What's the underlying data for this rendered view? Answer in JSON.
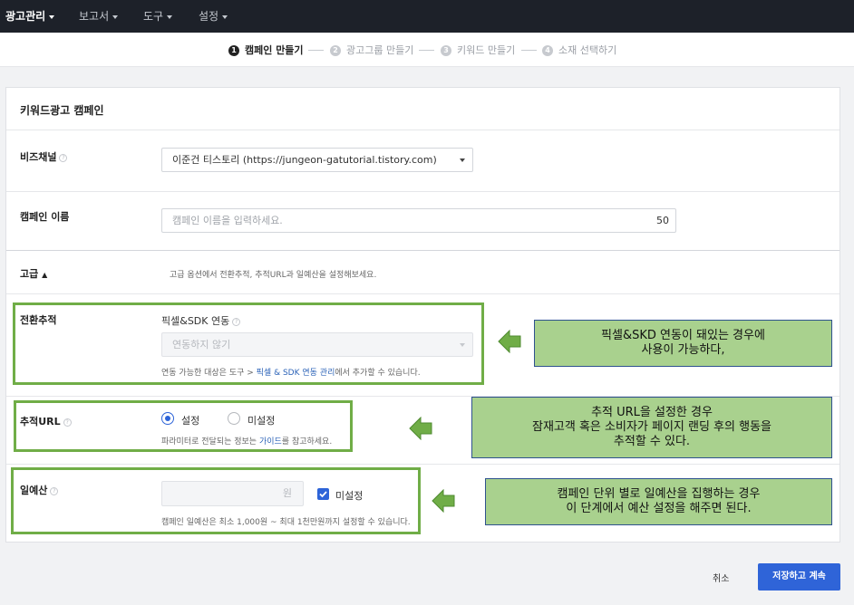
{
  "nav": {
    "items": [
      {
        "label": "광고관리"
      },
      {
        "label": "보고서"
      },
      {
        "label": "도구"
      },
      {
        "label": "설정"
      }
    ]
  },
  "steps": [
    {
      "num": "1",
      "label": "캠페인 만들기"
    },
    {
      "num": "2",
      "label": "광고그룹 만들기"
    },
    {
      "num": "3",
      "label": "키워드 만들기"
    },
    {
      "num": "4",
      "label": "소재 선택하기"
    }
  ],
  "card": {
    "title": "키워드광고 캠페인",
    "biz_channel": {
      "label": "비즈채널",
      "value": "이준건 티스토리 (https://jungeon-gatutorial.tistory.com)"
    },
    "campaign_name": {
      "label": "캠페인 이름",
      "placeholder": "캠페인 이름을 입력하세요.",
      "counter": "50"
    },
    "advanced": {
      "label": "고급",
      "description": "고급 옵션에서 전환추적, 추적URL과 일예산을 설정해보세요."
    },
    "conversion": {
      "label": "전환추적",
      "sub_label": "픽셀&SDK 연동",
      "select_value": "연동하지 않기",
      "hint_prefix": "연동 가능한 대상은 도구 > ",
      "hint_link": "픽셀 & SDK 연동 관리",
      "hint_suffix": "에서 추가할 수 있습니다."
    },
    "tracking_url": {
      "label": "추적URL",
      "option_on": "설정",
      "option_off": "미설정",
      "selected": "설정",
      "hint_prefix": "파라미터로 전달되는 정보는 ",
      "hint_link": "가이드",
      "hint_suffix": "를 참고하세요."
    },
    "daily_budget": {
      "label": "일예산",
      "unit": "원",
      "unset_label": "미설정",
      "unset_checked": true,
      "hint": "캠페인 일예산은 최소 1,000원 ~ 최대 1천만원까지 설정할 수 있습니다."
    }
  },
  "callouts": {
    "pixel": [
      "픽셀&SKD 연동이 돼있는 경우에",
      "사용이 가능하다,"
    ],
    "tracking": [
      "추적 URL을 설정한 경우",
      "잠재고객 혹은 소비자가 페이지 랜딩 후의 행동을",
      "추적할 수 있다."
    ],
    "budget": [
      "캠페인 단위 별로 일예산을 집행하는 경우",
      "이 단계에서 예산 설정을 해주면 된다."
    ]
  },
  "footer": {
    "cancel_label": "취소",
    "save_label": "저장하고 계속"
  },
  "colors": {
    "annotation_green": "#70ad47",
    "callout_fill": "#a9d18e",
    "primary": "#2f64d8"
  }
}
